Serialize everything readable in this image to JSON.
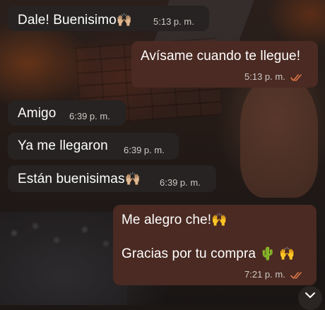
{
  "messages": [
    {
      "id": "m1",
      "direction": "in",
      "text": "Dale! Buenisimo",
      "emoji": "🙌🏼",
      "time": "5:13 p. m."
    },
    {
      "id": "m2",
      "direction": "out",
      "text": "Avísame cuando te llegue!",
      "time": "5:13 p. m.",
      "status": "read"
    },
    {
      "id": "m3",
      "direction": "in",
      "text": "Amigo",
      "time": "6:39 p. m."
    },
    {
      "id": "m4",
      "direction": "in",
      "text": "Ya me llegaron",
      "time": "6:39 p. m."
    },
    {
      "id": "m5",
      "direction": "in",
      "text": "Están buenisimas",
      "emoji": "🙌🏼",
      "time": "6:39 p. m."
    },
    {
      "id": "m6",
      "direction": "out",
      "line1": "Me alegro che!",
      "line1_emoji": "🙌",
      "line2": "Gracias por tu compra",
      "line2_emoji": "🌵 🙌",
      "time": "7:21 p. m.",
      "status": "read"
    }
  ],
  "colors": {
    "incoming_bubble": "#262322",
    "outgoing_bubble": "#4a2a22",
    "read_ticks": "#e0774a"
  },
  "icons": {
    "read_receipt": "double-check-icon",
    "scroll_down": "chevron-down-icon"
  }
}
